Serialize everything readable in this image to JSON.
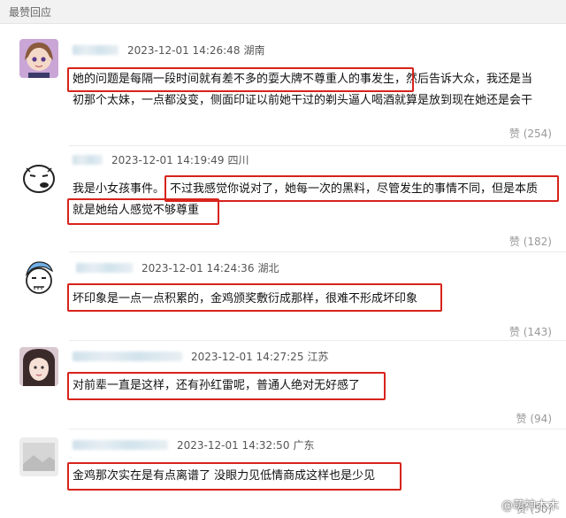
{
  "header": {
    "title": "最赞回应"
  },
  "comments": [
    {
      "time": "2023-12-01 14:26:48",
      "location": "湖南",
      "line1a": "她的问题是每隔一段时间就有差不多的耍大牌不尊重人的事发生",
      "line1b": "，然后告诉大众，我还是当",
      "line2": "初那个太妹，一点都没变，侧面印证以前她干过的剃头逼人喝酒就算是放到现在她还是会干",
      "likes": "赞 (254)"
    },
    {
      "time": "2023-12-01 14:19:49",
      "location": "四川",
      "line1a": "我是小女孩事件。",
      "line1b": "不过我感觉你说对了，她每一次的黑料，尽管发生的事情不同，但是本质",
      "line2": "就是她给人感觉不够尊重",
      "likes": "赞 (182)"
    },
    {
      "time": "2023-12-01 14:24:36",
      "location": "湖北",
      "line1a": "坏印象是一点一点积累的，金鸡颁奖敷衍成那样，很难不形成坏印象",
      "likes": "赞 (143)"
    },
    {
      "time": "2023-12-01 14:27:25",
      "location": "江苏",
      "line1a": "对前辈一直是这样，还有孙红雷呢，普通人绝对无好感了",
      "likes": "赞 (94)"
    },
    {
      "time": "2023-12-01 14:32:50",
      "location": "广东",
      "line1a": "金鸡那次实在是有点离谱了 没眼力见低情商成这样也是少见",
      "likes": "赞 (50)"
    }
  ],
  "watermark": "@萌神木木",
  "colors": {
    "highlight": "#d7231b",
    "header_bg": "#f2f2f2"
  }
}
